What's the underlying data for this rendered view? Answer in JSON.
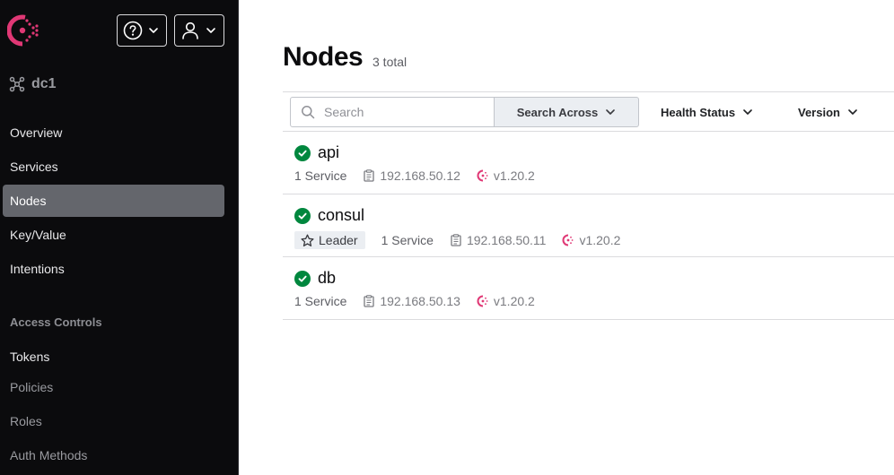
{
  "colors": {
    "brand": "#e03875",
    "sidebar_bg": "#0b0b0d",
    "nav_active_bg": "#64666c",
    "health_passing": "#00873e"
  },
  "header": {
    "logo_icon": "consul-logo-icon",
    "help_icon": "help-circle-icon",
    "user_icon": "user-icon"
  },
  "datacenter": {
    "icon": "datacenter-cluster-icon",
    "label": "dc1"
  },
  "nav": {
    "items": [
      {
        "label": "Overview",
        "active": false
      },
      {
        "label": "Services",
        "active": false
      },
      {
        "label": "Nodes",
        "active": true
      },
      {
        "label": "Key/Value",
        "active": false
      },
      {
        "label": "Intentions",
        "active": false
      }
    ],
    "section_label": "Access Controls",
    "acl_items": [
      {
        "label": "Tokens"
      },
      {
        "label": "Policies"
      },
      {
        "label": "Roles"
      },
      {
        "label": "Auth Methods"
      }
    ]
  },
  "page": {
    "title": "Nodes",
    "count": "3 total"
  },
  "toolbar": {
    "search_placeholder": "Search",
    "search_value": "",
    "search_across_label": "Search Across",
    "health_status_label": "Health Status",
    "version_label": "Version"
  },
  "nodes": [
    {
      "name": "api",
      "leader": false,
      "leader_label": "",
      "services": "1 Service",
      "ip": "192.168.50.12",
      "version": "v1.20.2",
      "status": "passing"
    },
    {
      "name": "consul",
      "leader": true,
      "leader_label": "Leader",
      "services": "1 Service",
      "ip": "192.168.50.11",
      "version": "v1.20.2",
      "status": "passing"
    },
    {
      "name": "db",
      "leader": false,
      "leader_label": "",
      "services": "1 Service",
      "ip": "192.168.50.13",
      "version": "v1.20.2",
      "status": "passing"
    }
  ]
}
